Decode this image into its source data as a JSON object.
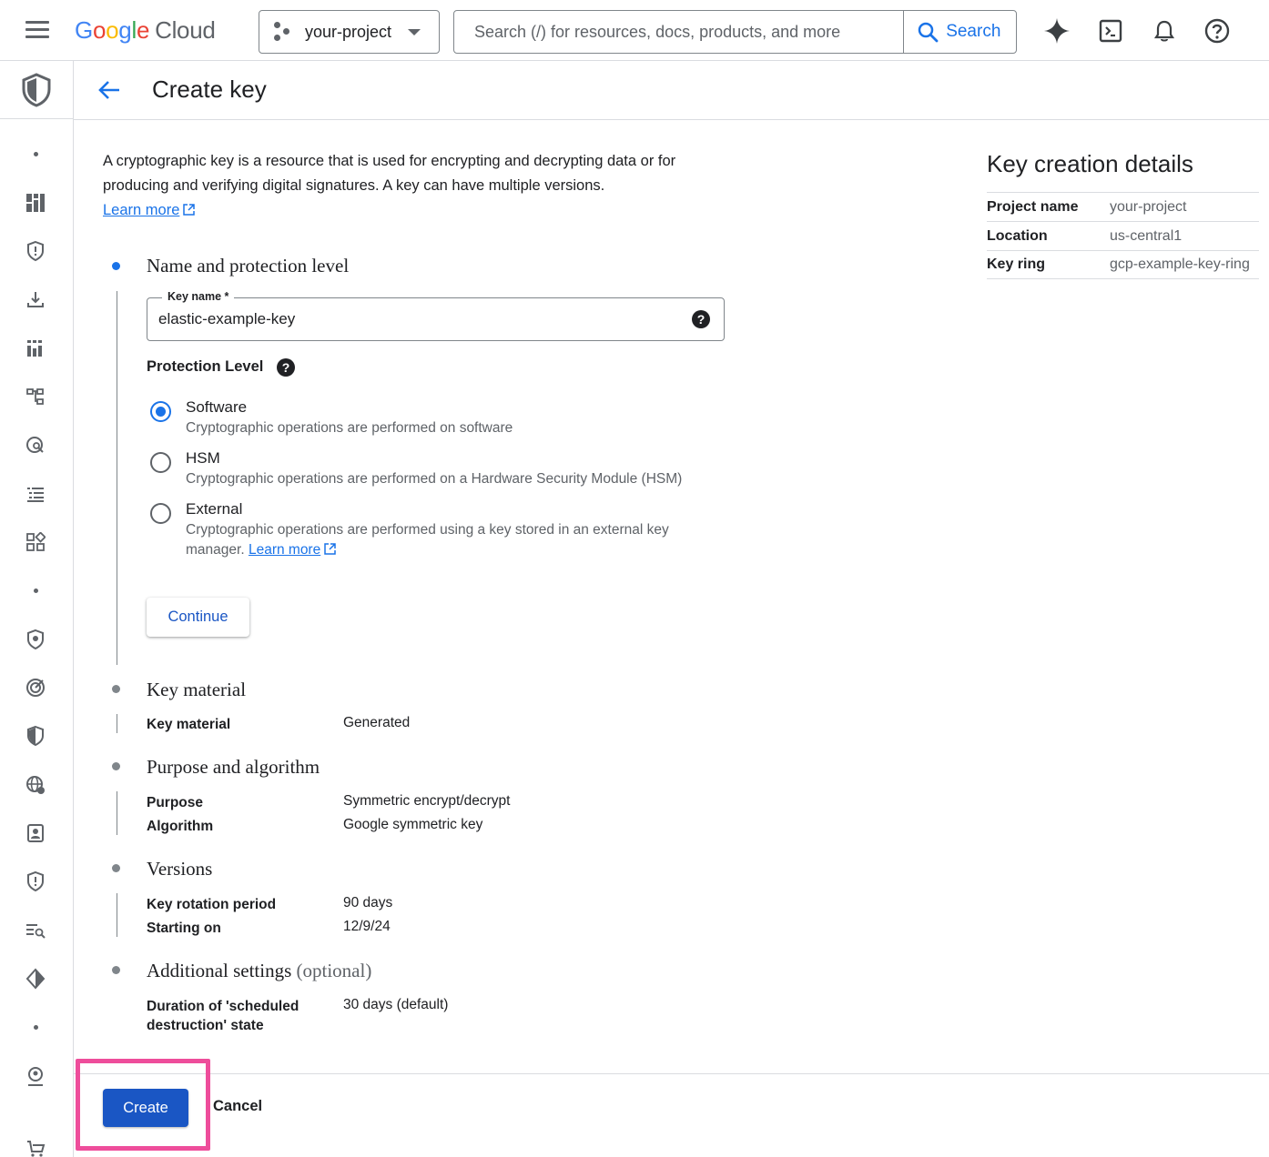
{
  "topbar": {
    "logo_google": [
      "G",
      "o",
      "o",
      "g",
      "l",
      "e"
    ],
    "logo_cloud": "Cloud",
    "project": "your-project",
    "search_placeholder": "Search (/) for resources, docs, products, and more",
    "search_label": "Search",
    "icons": [
      "gemini-sparkle-icon",
      "cloud-shell-icon",
      "notifications-bell-icon",
      "help-icon"
    ]
  },
  "header": {
    "title": "Create key"
  },
  "intro": {
    "text": "A cryptographic key is a resource that is used for encrypting and decrypting data or for producing and verifying digital signatures. A key can have multiple versions.",
    "learn_more": "Learn more"
  },
  "steps": {
    "name_protection": {
      "title": "Name and protection level",
      "key_name_label": "Key name *",
      "key_name_value": "elastic-example-key",
      "protection_level_label": "Protection Level",
      "options": [
        {
          "title": "Software",
          "desc": "Cryptographic operations are performed on software",
          "checked": true
        },
        {
          "title": "HSM",
          "desc": "Cryptographic operations are performed on a Hardware Security Module (HSM)",
          "checked": false
        },
        {
          "title": "External",
          "desc": "Cryptographic operations are performed using a key stored in an external key manager.",
          "checked": false
        }
      ],
      "external_learn_more": "Learn more",
      "continue_label": "Continue"
    },
    "key_material": {
      "title": "Key material",
      "rows": [
        {
          "key": "Key material",
          "value": "Generated"
        }
      ]
    },
    "purpose": {
      "title": "Purpose and algorithm",
      "rows": [
        {
          "key": "Purpose",
          "value": "Symmetric encrypt/decrypt"
        },
        {
          "key": "Algorithm",
          "value": "Google symmetric key"
        }
      ]
    },
    "versions": {
      "title": "Versions",
      "rows": [
        {
          "key": "Key rotation period",
          "value": "90 days"
        },
        {
          "key": "Starting on",
          "value": "12/9/24"
        }
      ]
    },
    "additional": {
      "title": "Additional settings",
      "optional": "(optional)",
      "rows": [
        {
          "key": "Duration of 'scheduled destruction' state",
          "value": "30 days (default)"
        }
      ]
    }
  },
  "details": {
    "title": "Key creation details",
    "rows": [
      {
        "key": "Project name",
        "value": "your-project"
      },
      {
        "key": "Location",
        "value": "us-central1"
      },
      {
        "key": "Key ring",
        "value": "gcp-example-key-ring"
      }
    ]
  },
  "footer": {
    "create_label": "Create",
    "cancel_label": "Cancel"
  },
  "colors": {
    "accent": "#1a73e8",
    "primary_button": "#1a56c4",
    "highlight": "#ee4d9b"
  }
}
